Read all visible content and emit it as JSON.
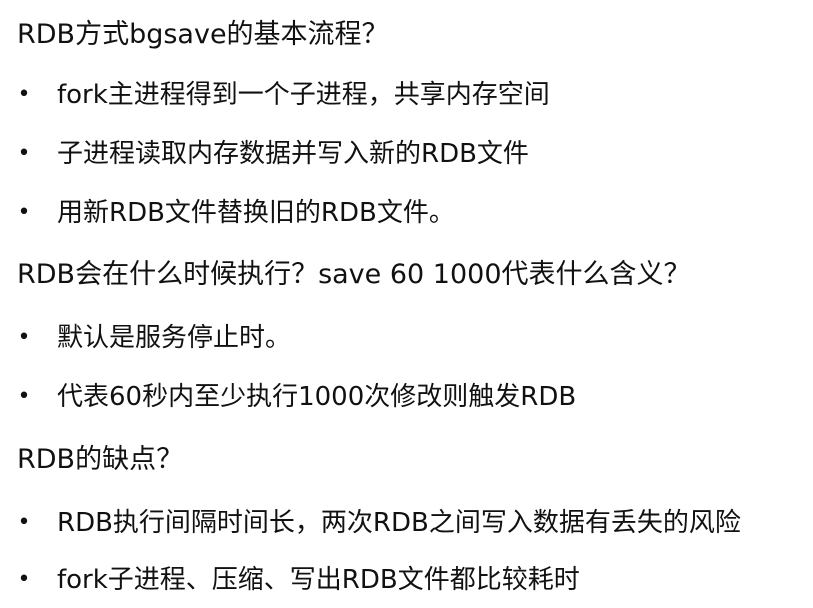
{
  "sections": [
    {
      "heading": "RDB方式bgsave的基本流程？",
      "items": [
        "fork主进程得到一个子进程，共享内存空间",
        "子进程读取内存数据并写入新的RDB文件",
        "用新RDB文件替换旧的RDB文件。"
      ]
    },
    {
      "heading": "RDB会在什么时候执行？save 60 1000代表什么含义？",
      "items": [
        "默认是服务停止时。",
        "代表60秒内至少执行1000次修改则触发RDB"
      ]
    },
    {
      "heading": "RDB的缺点？",
      "items": [
        "RDB执行间隔时间长，两次RDB之间写入数据有丢失的风险",
        "fork子进程、压缩、写出RDB文件都比较耗时"
      ]
    }
  ]
}
